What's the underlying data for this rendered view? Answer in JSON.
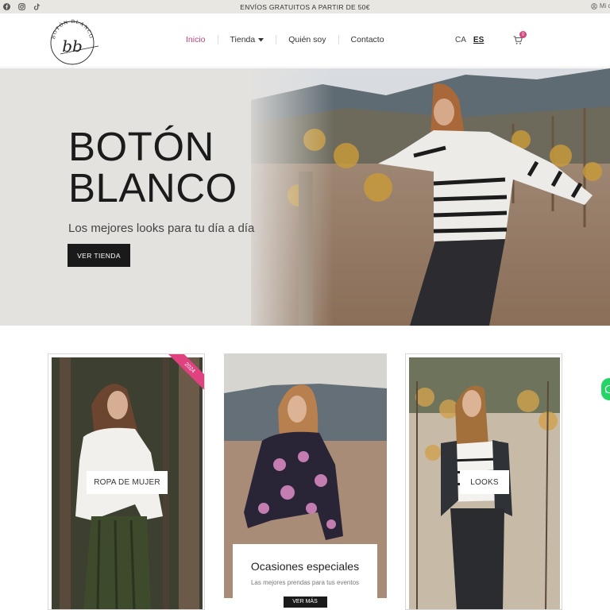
{
  "topbar": {
    "promo": "ENVÍOS GRATUITOS A PARTIR DE 50€",
    "account_label": "Mi cu",
    "social_icons": [
      "facebook-icon",
      "instagram-icon",
      "tiktok-icon"
    ]
  },
  "header": {
    "logo_text": "BOTÓN BLANCO",
    "logo_mark": "bb",
    "nav": [
      {
        "label": "Inicio",
        "active": true
      },
      {
        "label": "Tienda",
        "has_dropdown": true
      },
      {
        "label": "Quién soy"
      },
      {
        "label": "Contacto"
      }
    ],
    "languages": {
      "other": "CA",
      "current": "ES"
    },
    "cart_count": "0"
  },
  "hero": {
    "title_line1": "BOTÓN",
    "title_line2": "BLANCO",
    "subtitle": "Los mejores looks para tu día a día",
    "cta": "VER TIENDA"
  },
  "cards": {
    "women": {
      "label": "ROPA DE MUJER",
      "ribbon": "2024"
    },
    "occasions": {
      "title": "Ocasiones especiales",
      "subtitle": "Las mejores prendas para tus eventos",
      "cta": "VER MÁS"
    },
    "looks": {
      "label": "LOOKS"
    }
  },
  "colors": {
    "accent": "#c4417f",
    "ribbon": "#e0427f",
    "dark": "#1a1a1a",
    "topbar": "#e9e7e2",
    "whatsapp": "#25d366"
  }
}
